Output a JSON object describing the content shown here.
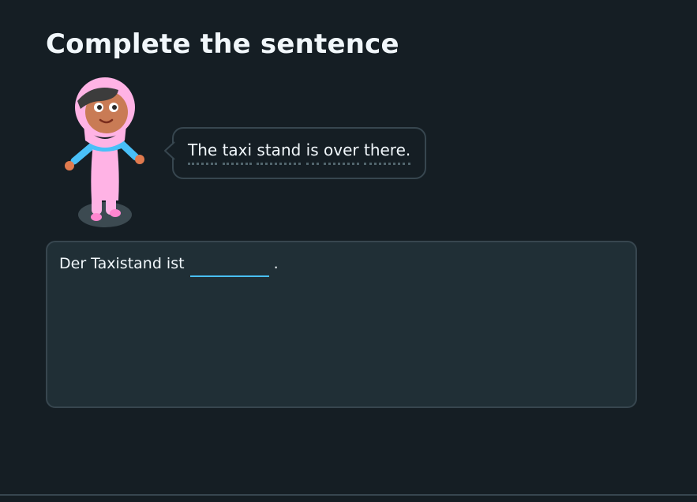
{
  "challenge": {
    "title": "Complete the sentence",
    "character_icon": "hijab-girl-character",
    "prompt_words": [
      "The",
      "taxi",
      "stand",
      "is",
      "over",
      "there."
    ],
    "sentence_prefix": "Der Taxistand ist",
    "sentence_suffix": ".",
    "answer_value": "",
    "answer_placeholder": ""
  },
  "colors": {
    "background": "#151e24",
    "card": "#202f36",
    "border": "#37464f",
    "blank_underline": "#49c0f8",
    "text": "#f1f7fb"
  }
}
